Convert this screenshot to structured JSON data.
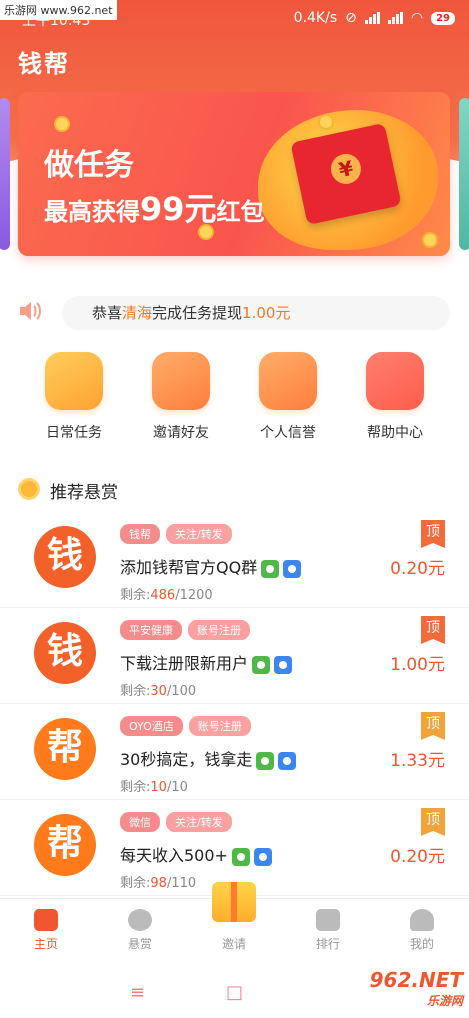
{
  "status": {
    "watermark": "乐游网 www.962.net",
    "time": "上午10:43",
    "network": "0.4K/s",
    "battery": "29"
  },
  "app_title": "钱帮",
  "banner": {
    "line1": "做任务",
    "line2_prefix": "最高获得",
    "line2_amount": "99元",
    "line2_suffix": "红包"
  },
  "notice": {
    "prefix": "恭喜",
    "name": "清海",
    "middle": "完成任务提现",
    "amount": "1.00元"
  },
  "quick_entries": [
    {
      "label": "日常任务",
      "icon": "checkbox-icon"
    },
    {
      "label": "邀请好友",
      "icon": "gift-icon"
    },
    {
      "label": "个人信誉",
      "icon": "star-badge-icon"
    },
    {
      "label": "帮助中心",
      "icon": "headset-icon"
    }
  ],
  "section_title": "推荐悬赏",
  "tasks": [
    {
      "avatar": "钱",
      "tags": [
        "钱帮",
        "关注/转发"
      ],
      "title": "添加钱帮官方QQ群",
      "remain_label": "剩余:",
      "remain": "486",
      "total": "/1200",
      "price": "0.20元",
      "pin": "顶"
    },
    {
      "avatar": "钱",
      "tags": [
        "平安健康",
        "账号注册"
      ],
      "title": "下载注册限新用户",
      "remain_label": "剩余:",
      "remain": "30",
      "total": "/100",
      "price": "1.00元",
      "pin": "顶"
    },
    {
      "avatar": "帮",
      "tags": [
        "OYO酒店",
        "账号注册"
      ],
      "title": "30秒搞定，钱拿走",
      "remain_label": "剩余:",
      "remain": "10",
      "total": "/10",
      "price": "1.33元",
      "pin": "顶"
    },
    {
      "avatar": "帮",
      "tags": [
        "微信",
        "关注/转发"
      ],
      "title": "每天收入500+",
      "remain_label": "剩余:",
      "remain": "98",
      "total": "/110",
      "price": "0.20元",
      "pin": "顶"
    }
  ],
  "tabbar": {
    "home": "主页",
    "reward": "悬赏",
    "invite": "邀请",
    "rank": "排行",
    "mine": "我的"
  },
  "site_watermark": {
    "brand": "962.NET",
    "sub": "乐游网"
  }
}
